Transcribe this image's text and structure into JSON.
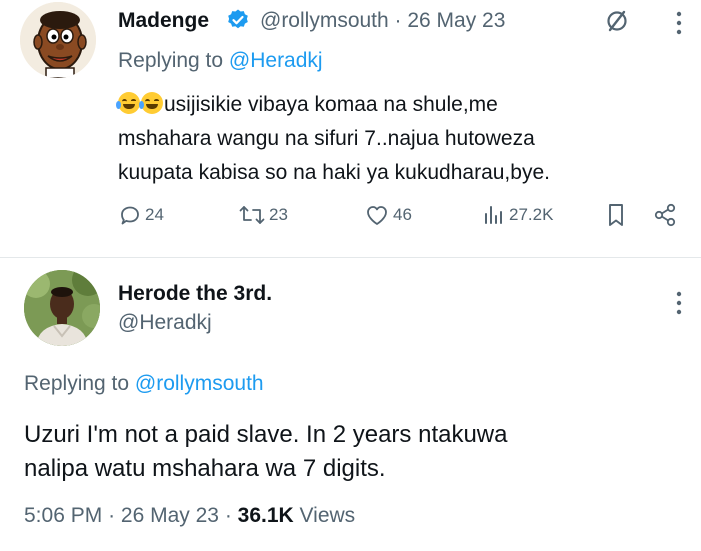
{
  "tweet1": {
    "author_name": "Madenge",
    "handle": "@rollymsouth",
    "date": "26 May 23",
    "replying_prefix": "Replying to",
    "replying_to": "@Heradkj",
    "body_line1": "usijisikie vibaya komaa na shule,me",
    "body_line2": "mshahara wangu na sifuri 7..najua hutoweza",
    "body_line3": "kuupata kabisa so na haki ya kukudharau,bye.",
    "replies": "24",
    "retweets": "23",
    "likes": "46",
    "views": "27.2K",
    "verified_color": "#1d9bf0"
  },
  "tweet2": {
    "author_name": "Herode the 3rd.",
    "handle": "@Heradkj",
    "replying_prefix": "Replying to",
    "replying_to": "@rollymsouth",
    "body_line1": "Uzuri I'm not a paid slave. In 2 years ntakuwa",
    "body_line2": "nalipa watu mshahara wa 7 digits.",
    "time": "5:06 PM",
    "separator": "·",
    "date": "26 May 23",
    "views_count": "36.1K",
    "views_label": "Views"
  },
  "colors": {
    "text_primary": "#0f1419",
    "text_secondary": "#536471",
    "accent": "#1d9bf0",
    "divider": "#e4e8ea"
  },
  "icons": {
    "verified": "verified-badge-icon",
    "grok": "slash-circle-icon",
    "more": "more-vertical-icon",
    "reply": "reply-bubble-icon",
    "retweet": "retweet-icon",
    "like": "heart-icon",
    "views": "bar-chart-icon",
    "bookmark": "bookmark-icon",
    "share": "share-icon"
  }
}
